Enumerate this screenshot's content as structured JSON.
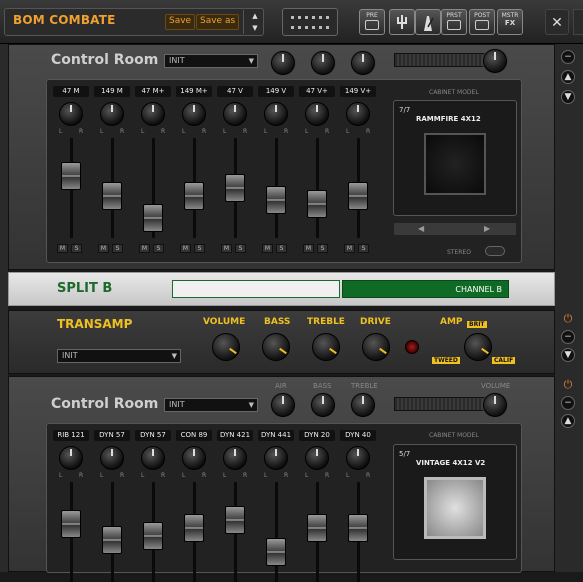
{
  "topbar": {
    "preset_name": "BOM COMBATE",
    "save": "Save",
    "save_as": "Save as",
    "fx_buttons": [
      {
        "label": "PRE",
        "icon": "pre-icon"
      },
      {
        "label": "",
        "icon": "tuner-icon"
      },
      {
        "label": "",
        "icon": "metronome-icon"
      },
      {
        "label": "PRST",
        "icon": "preset-icon"
      },
      {
        "label": "POST",
        "icon": "post-icon"
      },
      {
        "label": "MSTR",
        "icon": "master-icon"
      }
    ],
    "master_sub": "FX"
  },
  "control_room_1": {
    "title": "Control Room",
    "preset": "INIT",
    "cabinet_label": "CABINET MODEL",
    "cabinet_count": "7/7",
    "cabinet_name": "RAMMFIRE 4X12",
    "stereo_label": "STEREO",
    "channels": [
      "47 M",
      "149 M",
      "47 M+",
      "149 M+",
      "47 V",
      "149 V",
      "47 V+",
      "149 V+"
    ],
    "fader_levels": [
      0.3,
      0.55,
      0.82,
      0.55,
      0.45,
      0.6,
      0.65,
      0.55
    ]
  },
  "split": {
    "title": "SPLIT B",
    "channel_b": "CHANNEL B"
  },
  "transamp": {
    "title": "TRANSAMP",
    "preset": "INIT",
    "volume": "VOLUME",
    "bass": "BASS",
    "treble": "TREBLE",
    "drive": "DRIVE",
    "amp": "AMP",
    "brit": "BRIT",
    "tweed": "TWEED",
    "calif": "CALIF"
  },
  "control_room_2": {
    "title": "Control Room",
    "preset": "INIT",
    "air": "AIR",
    "bass": "BASS",
    "treble": "TREBLE",
    "volume": "VOLUME",
    "cabinet_label": "CABINET MODEL",
    "cabinet_count": "5/7",
    "cabinet_name": "VINTAGE 4X12 V2",
    "channels": [
      "RIB 121",
      "DYN 57",
      "DYN 57",
      "CON 89",
      "DYN 421",
      "DYN 441",
      "DYN 20",
      "DYN 40"
    ],
    "fader_levels": [
      0.35,
      0.55,
      0.5,
      0.4,
      0.3,
      0.7,
      0.4,
      0.4
    ]
  },
  "colors": {
    "accent_orange": "#f0a030",
    "transamp_yellow": "#f0c020",
    "split_green": "#0e6a24"
  }
}
